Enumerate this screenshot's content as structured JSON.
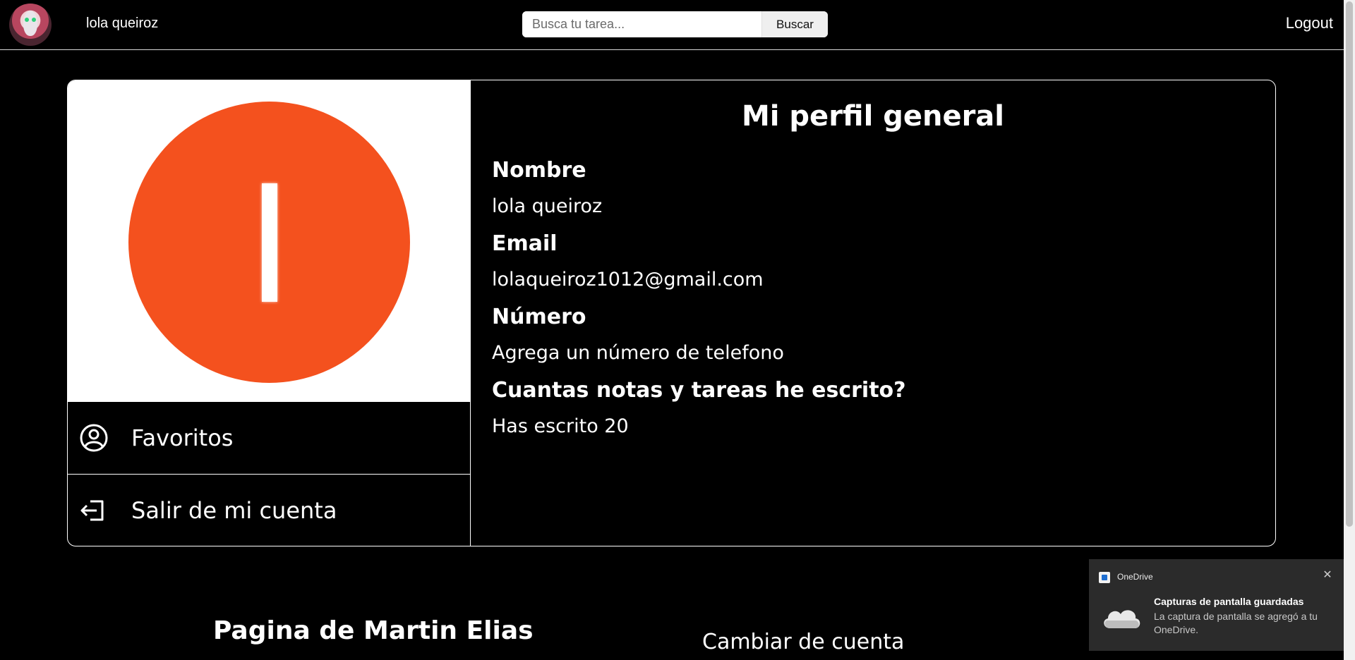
{
  "header": {
    "username": "lola queiroz",
    "search": {
      "placeholder": "Busca tu tarea...",
      "button_label": "Buscar"
    },
    "logout_label": "Logout"
  },
  "profile": {
    "avatar_letter": "l",
    "avatar_color": "#f4511e",
    "title": "Mi perfil general",
    "fields": [
      {
        "label": "Nombre",
        "value": "lola queiroz"
      },
      {
        "label": "Email",
        "value": "lolaqueiroz1012@gmail.com"
      },
      {
        "label": "Número",
        "value": "Agrega un número de telefono"
      },
      {
        "label": "Cuantas notas y tareas he escrito?",
        "value": "Has escrito 20"
      }
    ],
    "menu": [
      {
        "label": "Favoritos",
        "icon": "user-circle-icon"
      },
      {
        "label": "Salir de mi cuenta",
        "icon": "sign-out-icon"
      }
    ]
  },
  "footer": {
    "page_author": "Pagina de Martin Elias",
    "switch_account": "Cambiar de cuenta"
  },
  "notification": {
    "app_name": "OneDrive",
    "title": "Capturas de pantalla guardadas",
    "body": "La captura de pantalla se agregó a tu OneDrive.",
    "icon": "onedrive-cloud-icon"
  }
}
